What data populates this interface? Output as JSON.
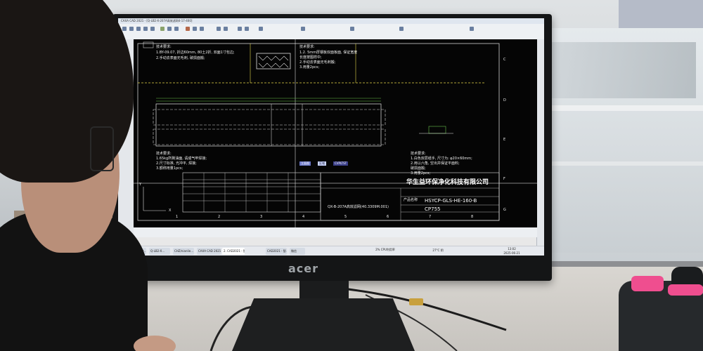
{
  "scene": {
    "description_label": "photo",
    "monitor_brand": "acer"
  },
  "cad": {
    "window_title": "CAXA CAD 2021 - [Q-LB2-X-207A高效滤网4-17-400]",
    "tech_req_top_left": {
      "heading": "技术要求:",
      "lines": [
        "1.BY-09.07, 折边60mm, 80土2折, 双面1寸包边;",
        "2.手动去表面无毛刺, 破损面搬;"
      ]
    },
    "tech_req_top_mid": {
      "heading": "技术要求:",
      "lines": [
        "1.2. 5mm厚钢板双面板面, 保证宽度",
        "长度按图样中;",
        "2.手动去表面无毛刺搬;",
        "3.用量2pcs;"
      ]
    },
    "tech_req_bottom_left": {
      "heading": "技术要求:",
      "lines": [
        "1.65kg所剩油面, 请成气牢焊接;",
        "2.尺寸标准, 光冲平, 焊接;",
        "3.额称用量1pcs;"
      ]
    },
    "tech_req_bottom_right": {
      "heading": "技术要求:",
      "lines": [
        "1.白色双层纸手, 尺寸为: φ20×60mm;",
        "2.用以六角, 空出并保证平面料;",
        "破损面搬;",
        "3.用量2pcs;"
      ]
    },
    "selection_tabs": [
      "立面图",
      "区域",
      "CVPLTST"
    ],
    "title_block": {
      "company": "华生益环保净化科技有限公司",
      "drawing_no": "QX-B-207A高效滤网(40.3309M.001)",
      "part_label": "产品名称",
      "part_no": "HSYCP-GLS-HE-160-B",
      "code": "CP755"
    },
    "axis_labels": [
      "Y",
      "X"
    ],
    "border_letters": [
      "C",
      "D",
      "E",
      "F",
      "G"
    ],
    "border_numbers": [
      "1",
      "2",
      "3",
      "4",
      "5",
      "6",
      "7",
      "8"
    ]
  },
  "taskbar": {
    "items": [
      "Kuto - 软件...",
      "Q-LB2-X...",
      "CHZ/nianlie...",
      "CAXA CAD 2021...",
      "2. CAD2021 - 智...",
      "CAD2021 - 智...",
      "微信"
    ],
    "weather": "27°C 阴",
    "stats": "2%\nCPU利用率",
    "time": "13:02",
    "date": "2025-06-21"
  }
}
